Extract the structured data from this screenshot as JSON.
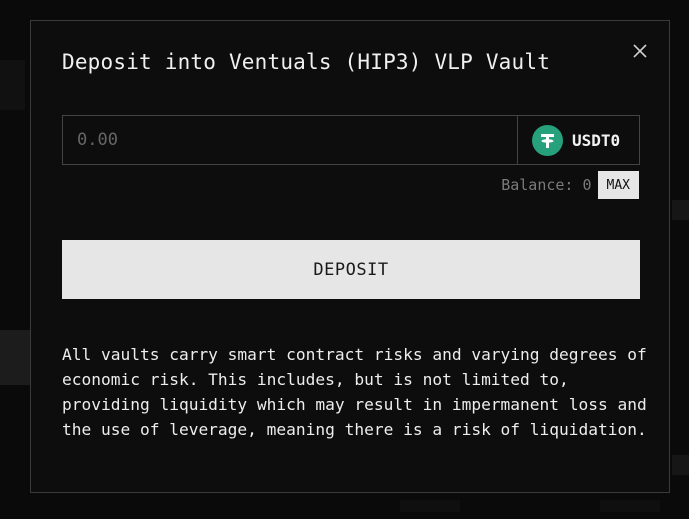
{
  "modal": {
    "title": "Deposit into Ventuals (HIP3) VLP Vault",
    "close_icon": "close-icon",
    "amount": {
      "value": "",
      "placeholder": "0.00"
    },
    "token": {
      "symbol": "USDT0",
      "icon": "usdt-icon",
      "icon_color": "#26a17b"
    },
    "balance": {
      "label": "Balance: 0",
      "max_label": "MAX"
    },
    "deposit_label": "DEPOSIT",
    "disclaimer": "All vaults carry smart contract risks and varying degrees of economic risk. This includes, but is not limited to, providing liquidity which may result in impermanent loss and the use of leverage, meaning there is a risk of liquidation."
  }
}
